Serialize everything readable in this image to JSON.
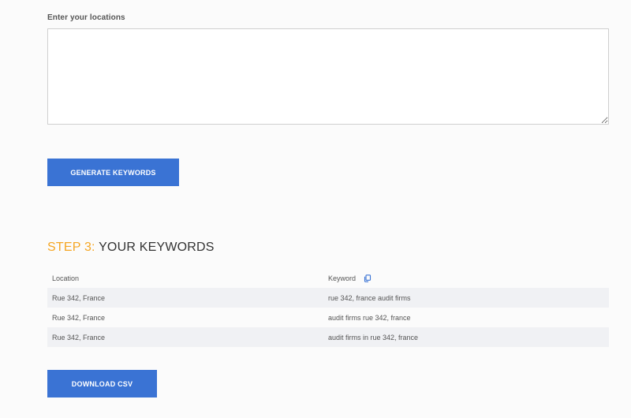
{
  "locations": {
    "label": "Enter your locations",
    "value": ""
  },
  "buttons": {
    "generate": "GENERATE KEYWORDS",
    "download": "DOWNLOAD CSV"
  },
  "step3": {
    "prefix": "STEP 3:",
    "title": "YOUR KEYWORDS"
  },
  "table": {
    "headers": {
      "location": "Location",
      "keyword": "Keyword"
    },
    "rows": [
      {
        "location": "Rue 342, France",
        "keyword": "rue 342, france audit firms"
      },
      {
        "location": "Rue 342, France",
        "keyword": "audit firms rue 342, france"
      },
      {
        "location": "Rue 342, France",
        "keyword": "audit firms in rue 342, france"
      }
    ]
  },
  "icons": {
    "copy": "copy-icon"
  },
  "colors": {
    "accent": "#f5a623",
    "button": "#3a73d4"
  }
}
